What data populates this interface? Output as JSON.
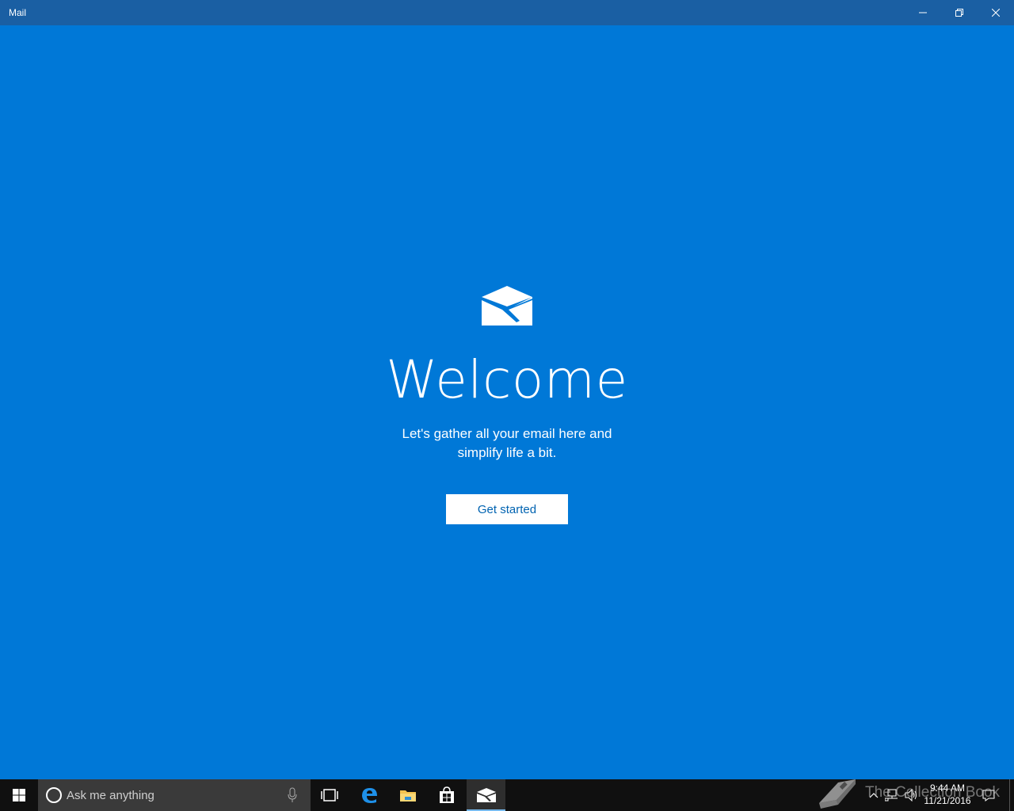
{
  "window": {
    "title": "Mail",
    "minimize_icon": "minimize-icon",
    "maximize_icon": "restore-icon",
    "close_icon": "close-icon"
  },
  "welcome": {
    "icon": "mail-envelope-icon",
    "title": "Welcome",
    "subtitle_line1": "Let's gather all your email here and",
    "subtitle_line2": "simplify life a bit.",
    "button_label": "Get started"
  },
  "taskbar": {
    "search_placeholder": "Ask me anything",
    "apps": [
      "task-view-icon",
      "edge-icon",
      "file-explorer-icon",
      "store-icon",
      "mail-icon"
    ],
    "clock_time": "9:44 AM",
    "clock_date": "11/21/2016"
  },
  "watermark": {
    "text": "The Collection Book"
  },
  "colors": {
    "accent": "#0078d7",
    "titlebar": "#1a5fa3",
    "button_text": "#0063b1",
    "taskbar": "#101010"
  }
}
